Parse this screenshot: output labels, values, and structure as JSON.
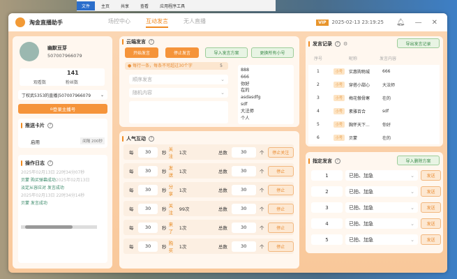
{
  "explorer": {
    "tabs": [
      "文件",
      "主页",
      "共享",
      "查看",
      "应用程序工具"
    ]
  },
  "app": {
    "title": "淘金直播助手",
    "nav": [
      "场控中心",
      "互动发言",
      "无人直播"
    ],
    "active_nav": 1,
    "vip": "VIP",
    "datetime": "2025-02-13 23:19:25"
  },
  "profile": {
    "name": "幽默豆芽",
    "id": "507007966079",
    "viewers_label": "观看数",
    "viewers": "",
    "fans_label": "粉丝数",
    "fans": "141",
    "room": "丁权武5353的直播|507007966079",
    "login": "登录主播号"
  },
  "push_card": {
    "title": "推送卡片",
    "apply": "启用",
    "interval": "间隔 200秒"
  },
  "oplog": {
    "title": "操作日志",
    "lines": [
      {
        "t": "2025年02月13日 22时34分07秒",
        "c": "gr"
      },
      {
        "t": "贝蒙  购买弹幕成功",
        "c": "g",
        "tail": "2025年02月13日"
      },
      {
        "t": "淡定从容应对  发言成功",
        "c": "g"
      },
      {
        "t": "2025年02月13日 22时34分14秒",
        "c": "gr"
      },
      {
        "t": "贝蒙  发言成功",
        "c": "g"
      }
    ]
  },
  "cloud": {
    "title": "云端发言",
    "start": "开始发言",
    "stop": "停止发言",
    "import": "导入发言方案",
    "switch": "更换所有小号",
    "hint": "每行一条，每条不可超过30个字",
    "count": "5",
    "order_placeholder": "顺序发言",
    "random_placeholder": "随机内容",
    "messages": [
      "888",
      "666",
      "你好",
      "在的",
      "asdasdfg",
      "sdf",
      "大法师",
      "个人"
    ]
  },
  "popularity": {
    "title": "人气互动",
    "every": "每",
    "sec": "秒",
    "total": "总数",
    "unit": "个",
    "rows": [
      {
        "interval": "30",
        "action": "关注",
        "times": "1次",
        "total": "30",
        "btn": "停止关注"
      },
      {
        "interval": "30",
        "action": "发送",
        "times": "1次",
        "total": "30",
        "btn": "停止"
      },
      {
        "interval": "30",
        "action": "分享",
        "times": "1次",
        "total": "30",
        "btn": "停止"
      },
      {
        "interval": "30",
        "action": "关注",
        "times": "99次",
        "total": "30",
        "btn": "停止"
      },
      {
        "interval": "30",
        "action": "来了",
        "times": "1次",
        "total": "30",
        "btn": "停止"
      },
      {
        "interval": "30",
        "action": "购买",
        "times": "1次",
        "total": "30",
        "btn": "停止"
      }
    ]
  },
  "records": {
    "title": "发言记录",
    "export": "导出发言记录",
    "headers": [
      "序号",
      "昵称",
      "发言内容"
    ],
    "rows": [
      {
        "n": "1",
        "tag": "小号",
        "nick": "实惠购物城",
        "msg": "666"
      },
      {
        "n": "2",
        "tag": "小号",
        "nick": "穿搭小甜心",
        "msg": "大法师"
      },
      {
        "n": "3",
        "tag": "小号",
        "nick": "梅花傲骨寒",
        "msg": "在的"
      },
      {
        "n": "4",
        "tag": "小号",
        "nick": "素雅百合",
        "msg": "sdf"
      },
      {
        "n": "5",
        "tag": "小号",
        "nick": "胸怀天下...",
        "msg": "你好"
      },
      {
        "n": "6",
        "tag": "小号",
        "nick": "贝蒙",
        "msg": "在的"
      }
    ]
  },
  "designated": {
    "title": "指定发言",
    "import": "导入删除方案",
    "send": "发送",
    "rows": [
      {
        "n": "1",
        "text": "已拍、加急"
      },
      {
        "n": "2",
        "text": "已拍、加急"
      },
      {
        "n": "3",
        "text": "已拍、加急"
      },
      {
        "n": "4",
        "text": "已拍、加急"
      },
      {
        "n": "5",
        "text": "已拍、加急"
      }
    ]
  }
}
